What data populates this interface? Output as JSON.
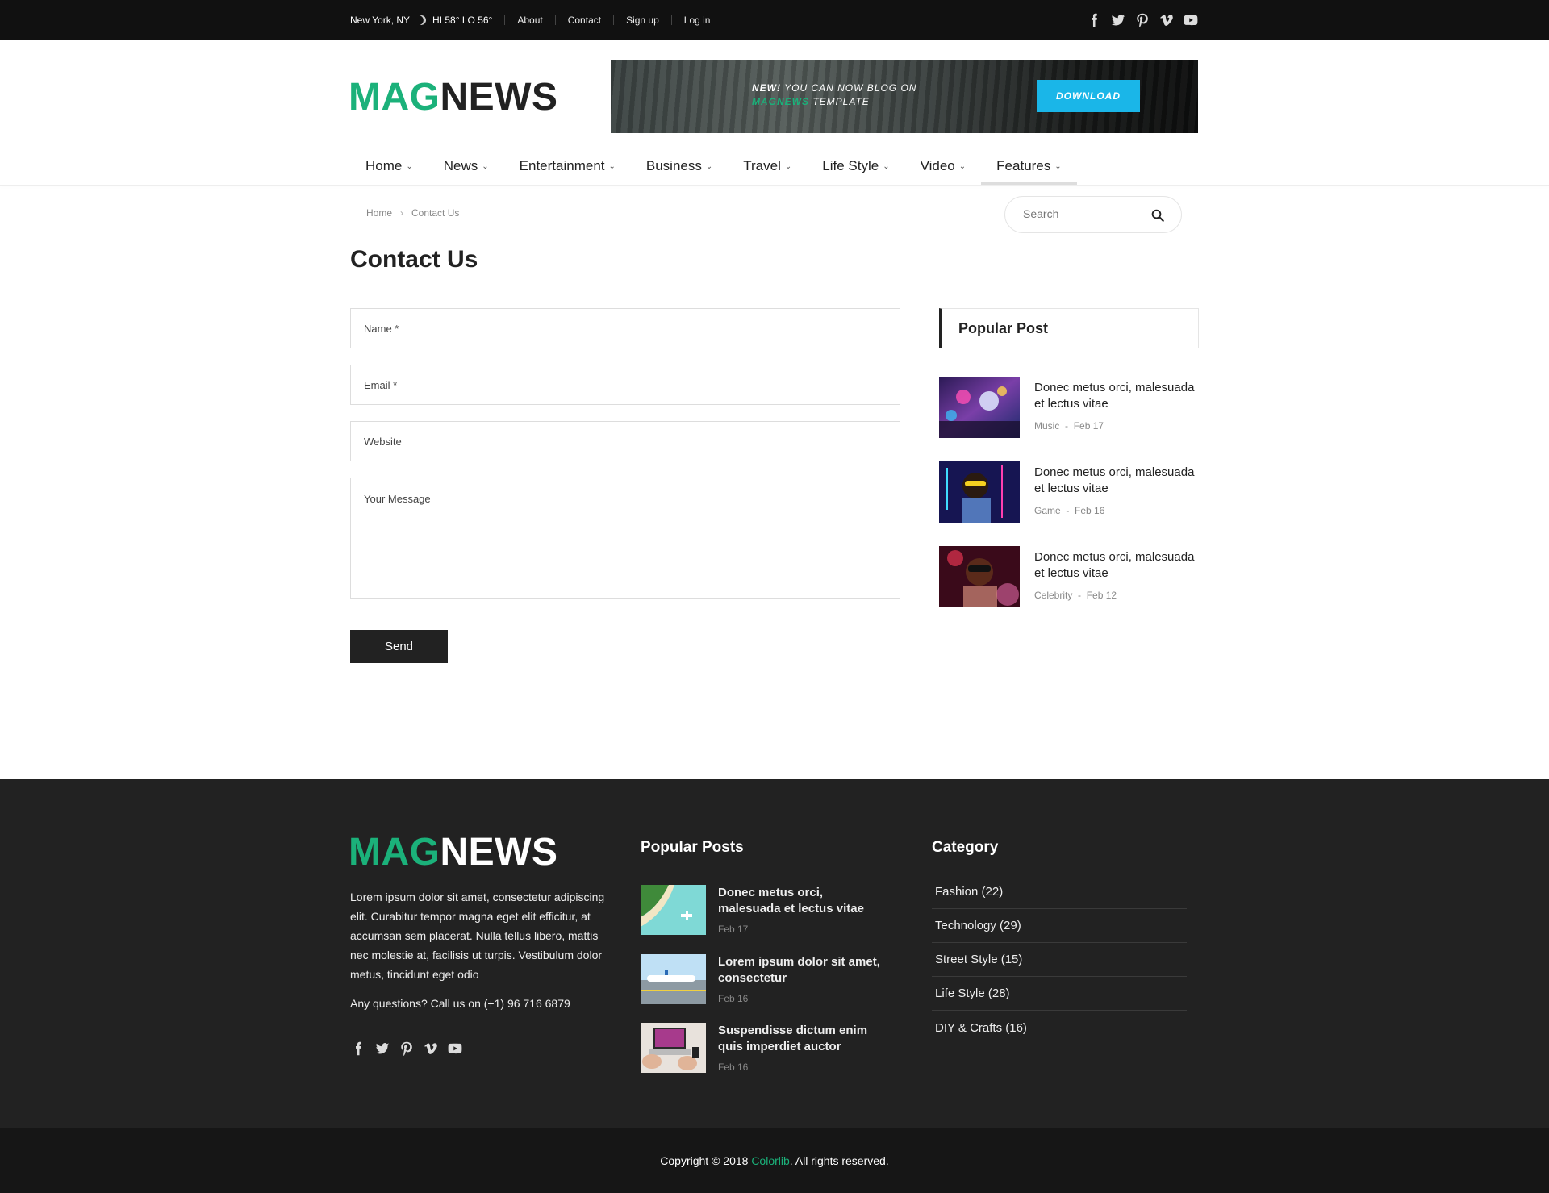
{
  "topbar": {
    "location": "New York, NY",
    "weather": "HI 58° LO 56°",
    "links": [
      "About",
      "Contact",
      "Sign up",
      "Log in"
    ],
    "social_icons": [
      "facebook-icon",
      "twitter-icon",
      "pinterest-icon",
      "vimeo-icon",
      "youtube-icon"
    ]
  },
  "header": {
    "logo_mag": "MAG",
    "logo_news": "NEWS",
    "ad": {
      "new": "NEW!",
      "line1": " YOU CAN NOW BLOG ON",
      "brand": "MAGNEWS",
      "line2": " TEMPLATE",
      "button": "DOWNLOAD"
    }
  },
  "nav": {
    "items": [
      {
        "label": "Home"
      },
      {
        "label": "News"
      },
      {
        "label": "Entertainment"
      },
      {
        "label": "Business"
      },
      {
        "label": "Travel"
      },
      {
        "label": "Life Style"
      },
      {
        "label": "Video"
      },
      {
        "label": "Features"
      }
    ],
    "active": "Features"
  },
  "breadcrumb": {
    "home": "Home",
    "current": "Contact Us"
  },
  "search": {
    "placeholder": "Search"
  },
  "page": {
    "title": "Contact Us"
  },
  "form": {
    "name_placeholder": "Name *",
    "email_placeholder": "Email *",
    "website_placeholder": "Website",
    "message_placeholder": "Your Message",
    "send_label": "Send"
  },
  "popular_post": {
    "title": "Popular Post",
    "items": [
      {
        "title": "Donec metus orci, malesuada et lectus vitae",
        "category": "Music",
        "date": "Feb 17"
      },
      {
        "title": "Donec metus orci, malesuada et lectus vitae",
        "category": "Game",
        "date": "Feb 16"
      },
      {
        "title": "Donec metus orci, malesuada et lectus vitae",
        "category": "Celebrity",
        "date": "Feb 12"
      }
    ]
  },
  "footer": {
    "logo_mag": "MAG",
    "logo_news": "NEWS",
    "about": "Lorem ipsum dolor sit amet, consectetur adipiscing elit. Curabitur tempor magna eget elit efficitur, at accumsan sem placerat. Nulla tellus libero, mattis nec molestie at, facilisis ut turpis. Vestibulum dolor metus, tincidunt eget odio",
    "call": "Any questions? Call us on (+1) 96 716 6879",
    "popular_title": "Popular Posts",
    "popular": [
      {
        "title": "Donec metus orci, malesuada et lectus vitae",
        "date": "Feb 17"
      },
      {
        "title": "Lorem ipsum dolor sit amet, consectetur",
        "date": "Feb 16"
      },
      {
        "title": "Suspendisse dictum enim quis imperdiet auctor",
        "date": "Feb 16"
      }
    ],
    "category_title": "Category",
    "categories": [
      "Fashion (22)",
      "Technology (29)",
      "Street Style (15)",
      "Life Style (28)",
      "DIY & Crafts (16)"
    ]
  },
  "copyright": {
    "prefix": "Copyright © 2018 ",
    "brand": "Colorlib",
    "suffix": ". All rights reserved."
  }
}
